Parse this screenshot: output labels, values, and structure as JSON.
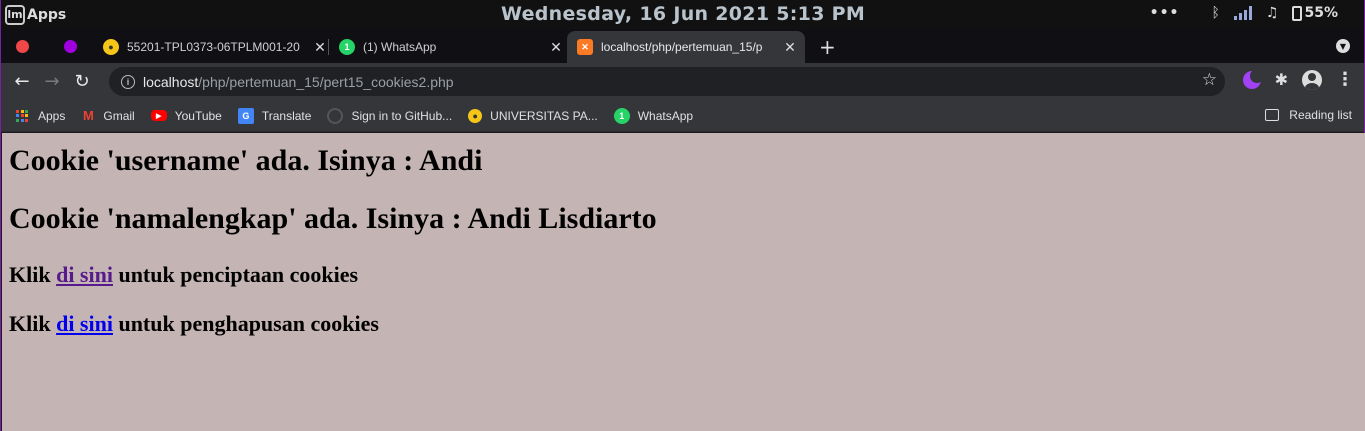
{
  "os": {
    "apps_label": "Apps",
    "clock": "Wednesday, 16 Jun 2021  5:13 PM",
    "more": "•••",
    "battery": "55%"
  },
  "tabs": [
    {
      "label": "55201-TPL0373-06TPLM001-20",
      "favicon_color": "#f5c518"
    },
    {
      "label": "(1) WhatsApp",
      "favicon_color": "#25d366"
    },
    {
      "label": "localhost/php/pertemuan_15/p",
      "favicon_color": "#fb7a24"
    }
  ],
  "toolbar": {
    "url_host": "localhost",
    "url_path": "/php/pertemuan_15/pert15_cookies2.php"
  },
  "bookmarks": {
    "items": [
      {
        "label": "Apps"
      },
      {
        "label": "Gmail"
      },
      {
        "label": "YouTube"
      },
      {
        "label": "Translate"
      },
      {
        "label": "Sign in to GitHub..."
      },
      {
        "label": "UNIVERSITAS PA..."
      },
      {
        "label": "WhatsApp"
      }
    ],
    "reading_list": "Reading list"
  },
  "page": {
    "line1": "Cookie 'username' ada. Isinya : Andi",
    "line2": "Cookie 'namalengkap' ada. Isinya : Andi Lisdiarto",
    "create_prefix": "Klik ",
    "create_link": "di sini",
    "create_suffix": " untuk penciptaan cookies",
    "delete_prefix": "Klik ",
    "delete_link": "di sini",
    "delete_suffix": " untuk penghapusan cookies",
    "background": "#c5b4b4"
  }
}
